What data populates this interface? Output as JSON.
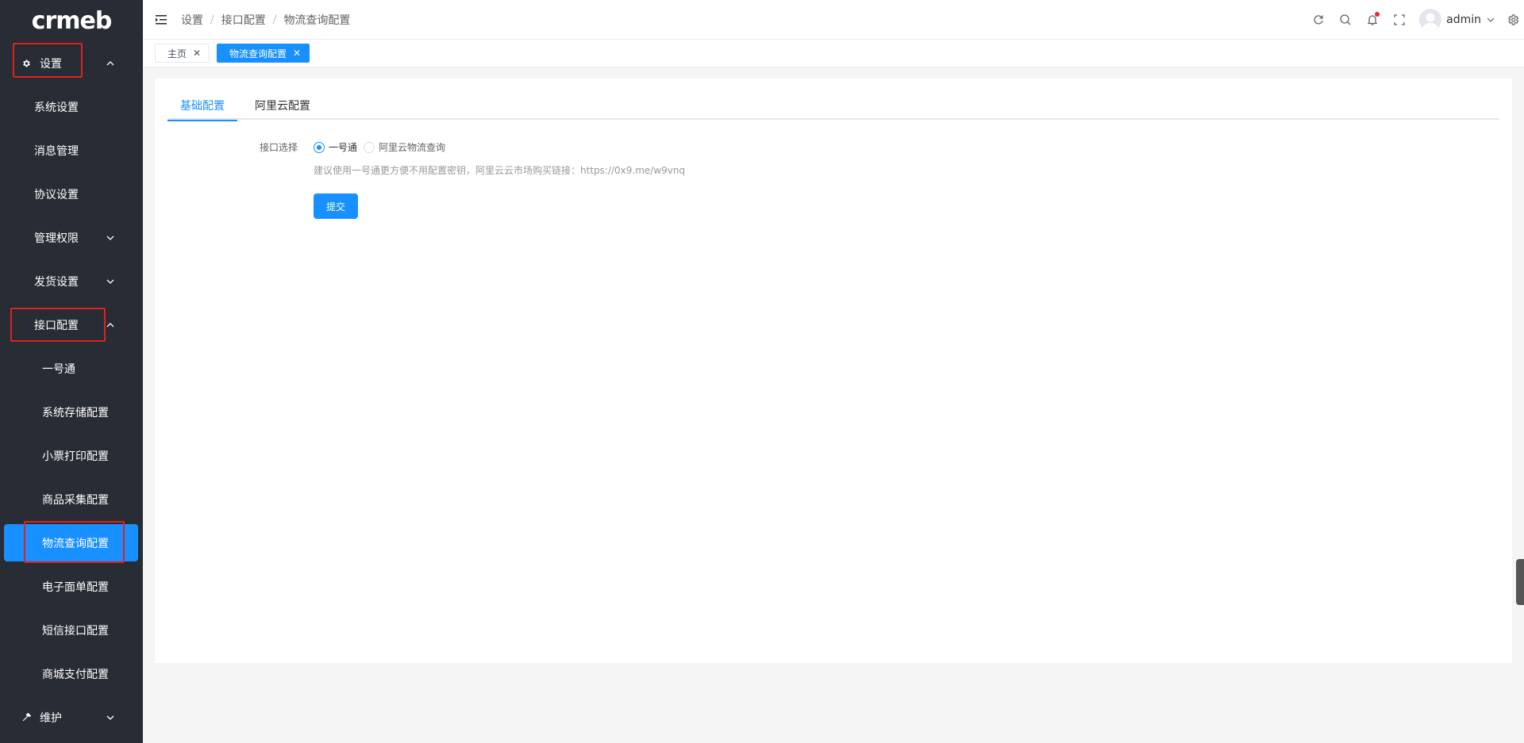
{
  "sidebar": {
    "logo": "crmeb",
    "items": [
      {
        "label": "设置"
      },
      {
        "label": "系统设置"
      },
      {
        "label": "消息管理"
      },
      {
        "label": "协议设置"
      },
      {
        "label": "管理权限"
      },
      {
        "label": "发货设置"
      },
      {
        "label": "接口配置"
      },
      {
        "label": "一号通"
      },
      {
        "label": "系统存储配置"
      },
      {
        "label": "小票打印配置"
      },
      {
        "label": "商品采集配置"
      },
      {
        "label": "物流查询配置"
      },
      {
        "label": "电子面单配置"
      },
      {
        "label": "短信接口配置"
      },
      {
        "label": "商城支付配置"
      },
      {
        "label": "维护"
      }
    ]
  },
  "header": {
    "breadcrumb": [
      "设置",
      "接口配置",
      "物流查询配置"
    ],
    "separator": "/",
    "username": "admin"
  },
  "tags": {
    "home": "主页",
    "current": "物流查询配置",
    "close": "✕"
  },
  "main": {
    "tabs": [
      {
        "label": "基础配置",
        "active": true
      },
      {
        "label": "阿里云配置",
        "active": false
      }
    ],
    "form": {
      "interface_label": "接口选择",
      "options": [
        {
          "label": "一号通",
          "checked": true
        },
        {
          "label": "阿里云物流查询",
          "checked": false
        }
      ],
      "hint": "建议使用一号通更方便不用配置密钥，阿里云云市场购买链接：https://0x9.me/w9vnq",
      "submit_label": "提交"
    }
  },
  "colors": {
    "sidebar_bg": "#282c34",
    "accent": "#1890ff",
    "highlight_box": "#e02020"
  }
}
